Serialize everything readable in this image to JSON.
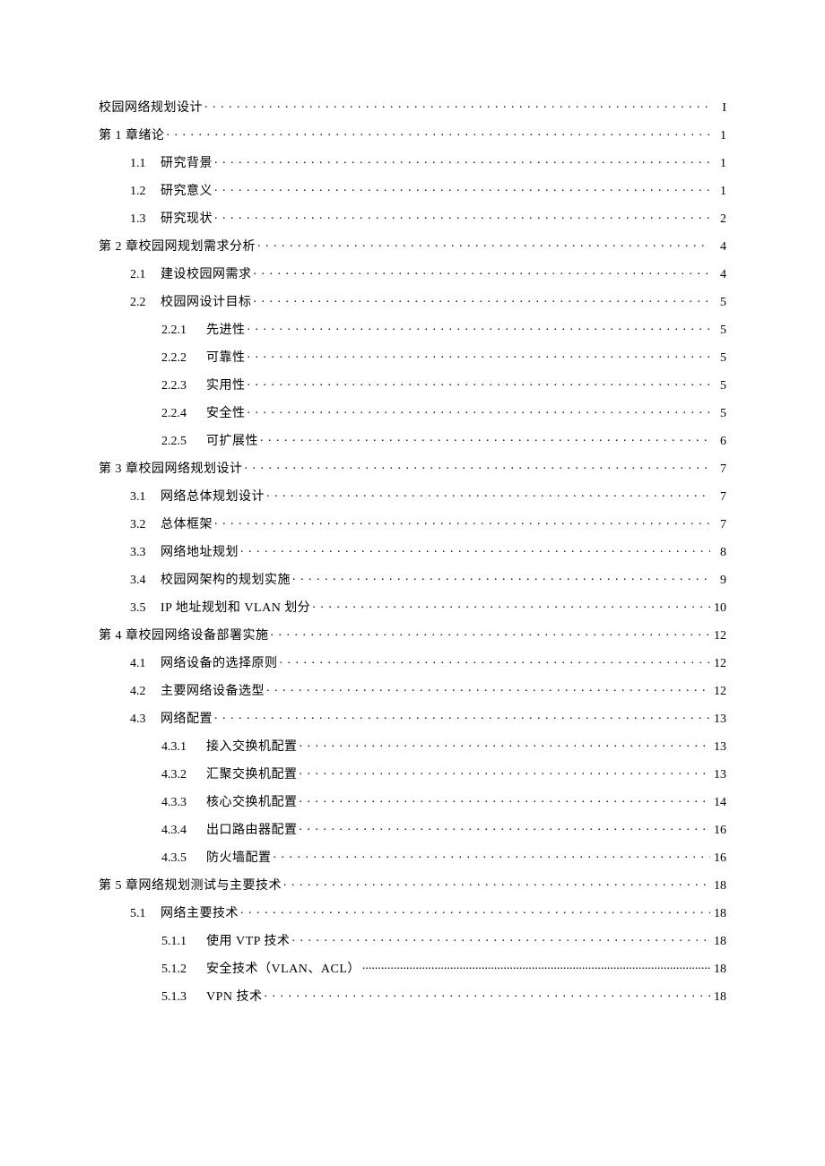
{
  "toc": [
    {
      "level": 0,
      "num": "",
      "title": "校园网络规划设计",
      "page": "I",
      "dense": false
    },
    {
      "level": 0,
      "num": "",
      "title": "第 1 章绪论",
      "page": "1",
      "dense": false
    },
    {
      "level": 1,
      "num": "1.1",
      "title": "研究背景",
      "page": "1",
      "dense": false
    },
    {
      "level": 1,
      "num": "1.2",
      "title": "研究意义",
      "page": "1",
      "dense": false
    },
    {
      "level": 1,
      "num": "1.3",
      "title": "研究现状",
      "page": "2",
      "dense": false
    },
    {
      "level": 0,
      "num": "",
      "title": "第 2 章校园网规划需求分析",
      "page": "4",
      "dense": false
    },
    {
      "level": 1,
      "num": "2.1",
      "title": "建设校园网需求",
      "page": "4",
      "dense": false
    },
    {
      "level": 1,
      "num": "2.2",
      "title": "校园网设计目标",
      "page": "5",
      "dense": false
    },
    {
      "level": 2,
      "num": "2.2.1",
      "title": "先进性",
      "page": "5",
      "dense": false
    },
    {
      "level": 2,
      "num": "2.2.2",
      "title": "可靠性",
      "page": "5",
      "dense": false
    },
    {
      "level": 2,
      "num": "2.2.3",
      "title": "实用性",
      "page": "5",
      "dense": false
    },
    {
      "level": 2,
      "num": "2.2.4",
      "title": "安全性",
      "page": "5",
      "dense": false
    },
    {
      "level": 2,
      "num": "2.2.5",
      "title": "可扩展性",
      "page": "6",
      "dense": false
    },
    {
      "level": 0,
      "num": "",
      "title": "第 3 章校园网络规划设计",
      "page": "7",
      "dense": false
    },
    {
      "level": 1,
      "num": "3.1",
      "title": "网络总体规划设计",
      "page": "7",
      "dense": false
    },
    {
      "level": 1,
      "num": "3.2",
      "title": "总体框架",
      "page": "7",
      "dense": false
    },
    {
      "level": 1,
      "num": "3.3",
      "title": "网络地址规划",
      "page": "8",
      "dense": false
    },
    {
      "level": 1,
      "num": "3.4",
      "title": "校园网架构的规划实施",
      "page": "9",
      "dense": false
    },
    {
      "level": 1,
      "num": "3.5",
      "title": "IP 地址规划和 VLAN 划分",
      "page": "10",
      "dense": false
    },
    {
      "level": 0,
      "num": "",
      "title": "第 4 章校园网络设备部署实施",
      "page": "12",
      "dense": false
    },
    {
      "level": 1,
      "num": "4.1",
      "title": "网络设备的选择原则",
      "page": "12",
      "dense": false
    },
    {
      "level": 1,
      "num": "4.2",
      "title": "主要网络设备选型",
      "page": "12",
      "dense": false
    },
    {
      "level": 1,
      "num": "4.3",
      "title": "网络配置",
      "page": "13",
      "dense": false
    },
    {
      "level": 2,
      "num": "4.3.1",
      "title": "接入交换机配置",
      "page": "13",
      "dense": false
    },
    {
      "level": 2,
      "num": "4.3.2",
      "title": "汇聚交换机配置",
      "page": "13",
      "dense": false
    },
    {
      "level": 2,
      "num": "4.3.3",
      "title": "核心交换机配置",
      "page": "14",
      "dense": false
    },
    {
      "level": 2,
      "num": "4.3.4",
      "title": "出口路由器配置",
      "page": "16",
      "dense": false
    },
    {
      "level": 2,
      "num": "4.3.5",
      "title": "防火墙配置",
      "page": "16",
      "dense": false
    },
    {
      "level": 0,
      "num": "",
      "title": "第 5 章网络规划测试与主要技术",
      "page": "18",
      "dense": false
    },
    {
      "level": 1,
      "num": "5.1",
      "title": "网络主要技术",
      "page": "18",
      "dense": false
    },
    {
      "level": 2,
      "num": "5.1.1",
      "title": "使用 VTP 技术",
      "page": "18",
      "dense": false
    },
    {
      "level": 2,
      "num": "5.1.2",
      "title": "安全技术（VLAN、ACL）",
      "page": "18",
      "dense": true
    },
    {
      "level": 2,
      "num": "5.1.3",
      "title": "VPN 技术",
      "page": "18",
      "dense": false
    }
  ]
}
